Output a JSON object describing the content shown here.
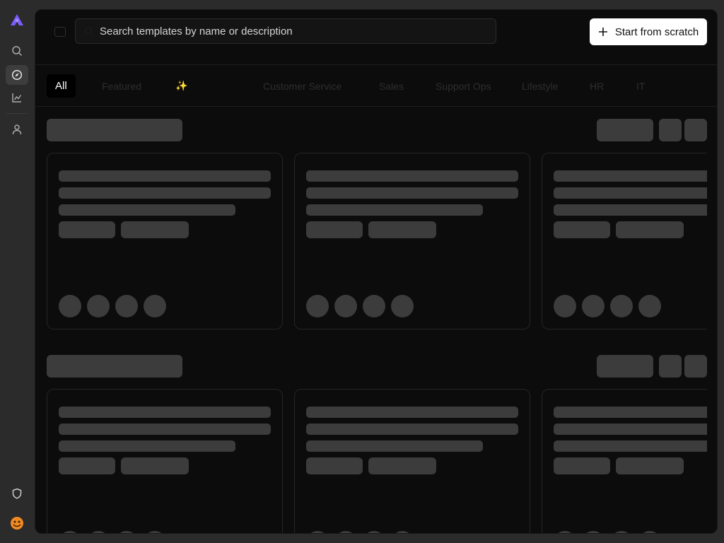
{
  "sidebar": {
    "icons": [
      "logo-icon",
      "search-icon",
      "compass-icon",
      "chart-icon",
      "user-icon",
      "shield-icon",
      "avatar-icon"
    ],
    "active": "compass-icon",
    "colors": {
      "logo": "#7c5cff",
      "avatar": "#f08a24"
    }
  },
  "header": {
    "search_placeholder": "Search templates by name or description",
    "start_button_label": "Start from scratch"
  },
  "tabs": [
    {
      "label": "All",
      "active": true
    },
    {
      "label": "Featured",
      "active": false
    },
    {
      "label": "✨",
      "active": false
    },
    {
      "label": "Customer Service",
      "active": false
    },
    {
      "label": "Sales",
      "active": false
    },
    {
      "label": "Support Ops",
      "active": false
    },
    {
      "label": "Lifestyle",
      "active": false
    },
    {
      "label": "HR",
      "active": false
    },
    {
      "label": "IT",
      "active": false
    }
  ],
  "loading": true
}
